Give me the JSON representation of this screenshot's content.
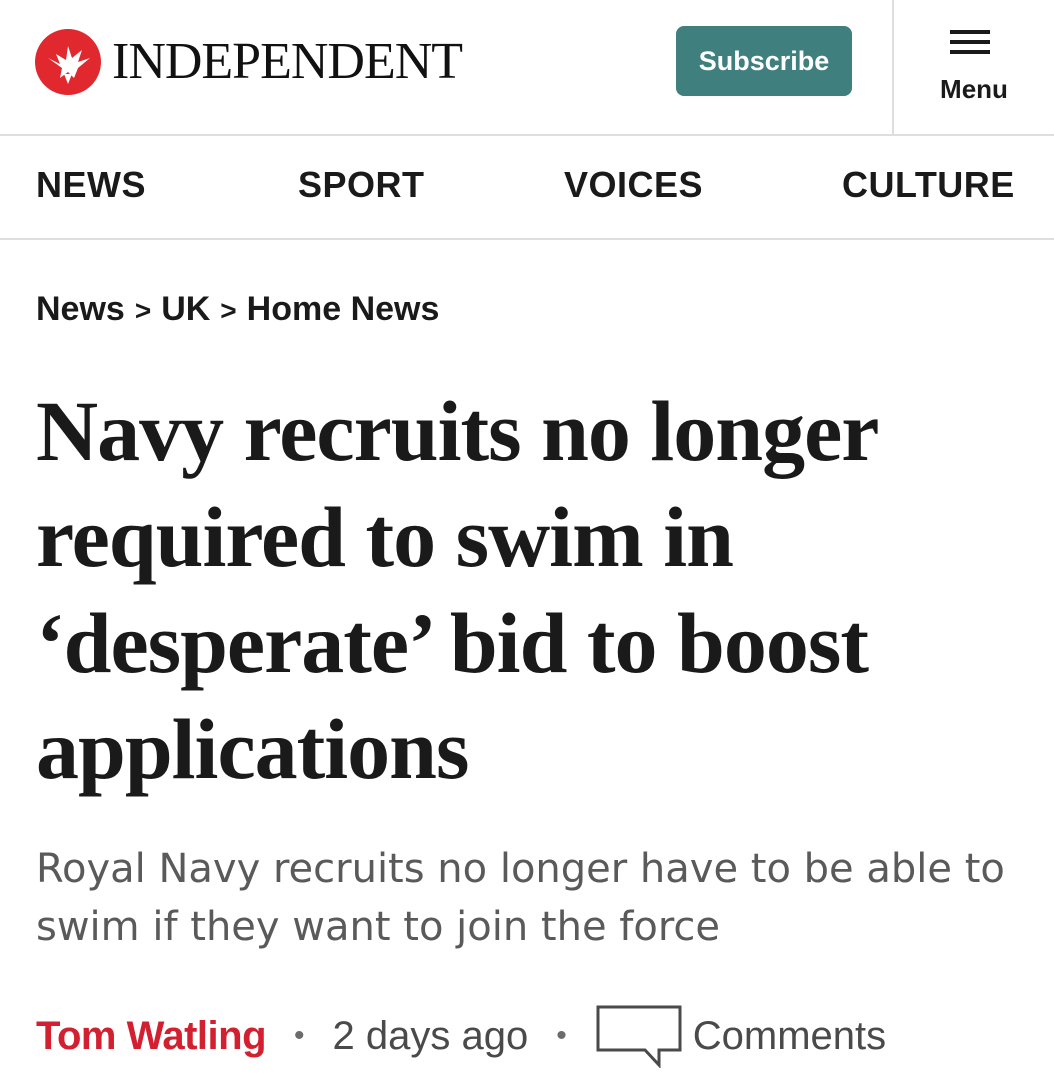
{
  "header": {
    "logo_text": "INDEPENDENT",
    "subscribe_label": "Subscribe",
    "menu_label": "Menu",
    "brand_color": "#e0282e",
    "subscribe_color": "#3f7f7e"
  },
  "nav": {
    "items": [
      {
        "label": "NEWS"
      },
      {
        "label": "SPORT"
      },
      {
        "label": "VOICES"
      },
      {
        "label": "CULTURE"
      }
    ]
  },
  "breadcrumb": {
    "items": [
      "News",
      "UK",
      "Home News"
    ],
    "separator": ">"
  },
  "article": {
    "headline": "Navy recruits no longer required to swim in ‘desperate’ bid to boost applications",
    "standfirst": "Royal Navy recruits no longer have to be able to swim if they want to join the force",
    "author": "Tom Watling",
    "time": "2 days ago",
    "comments_label": "Comments",
    "author_color": "#d32030"
  },
  "icons": {
    "logo": "eagle-icon",
    "menu": "hamburger-icon",
    "comments": "speech-bubble-icon"
  }
}
